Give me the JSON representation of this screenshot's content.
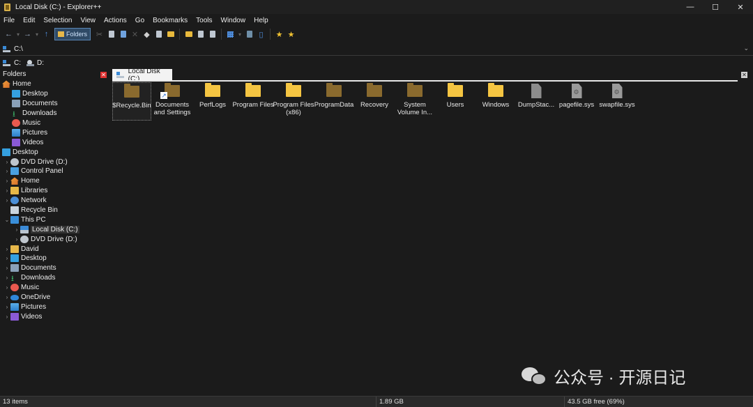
{
  "window": {
    "title": "Local Disk (C:) - Explorer++",
    "controls": [
      "—",
      "☐",
      "✕"
    ]
  },
  "menu": [
    "File",
    "Edit",
    "Selection",
    "View",
    "Actions",
    "Go",
    "Bookmarks",
    "Tools",
    "Window",
    "Help"
  ],
  "toolbar": {
    "folders_label": "Folders"
  },
  "address": {
    "path": "C:\\"
  },
  "drives": [
    "C:",
    "D:"
  ],
  "folders_pane": {
    "header": "Folders",
    "items": [
      {
        "label": "Home",
        "icon": "home-icon"
      },
      {
        "label": "Desktop",
        "icon": "desktop-icon"
      },
      {
        "label": "Documents",
        "icon": "documents-icon"
      },
      {
        "label": "Downloads",
        "icon": "downloads-icon"
      },
      {
        "label": "Music",
        "icon": "music-icon"
      },
      {
        "label": "Pictures",
        "icon": "pictures-icon"
      },
      {
        "label": "Videos",
        "icon": "videos-icon"
      },
      {
        "label": "Desktop",
        "icon": "desktop-icon"
      },
      {
        "label": "DVD Drive (D:)",
        "icon": "dvd-drive-icon"
      },
      {
        "label": "Control Panel",
        "icon": "control-panel-icon"
      },
      {
        "label": "Home",
        "icon": "home-icon"
      },
      {
        "label": "Libraries",
        "icon": "libraries-icon"
      },
      {
        "label": "Network",
        "icon": "network-icon"
      },
      {
        "label": "Recycle Bin",
        "icon": "recycle-bin-icon"
      },
      {
        "label": "This PC",
        "icon": "this-pc-icon"
      },
      {
        "label": "Local Disk (C:)",
        "icon": "local-disk-icon"
      },
      {
        "label": "DVD Drive (D:)",
        "icon": "dvd-drive-icon"
      },
      {
        "label": "David",
        "icon": "folder-icon"
      },
      {
        "label": "Desktop",
        "icon": "desktop-icon"
      },
      {
        "label": "Documents",
        "icon": "documents-icon"
      },
      {
        "label": "Downloads",
        "icon": "downloads-icon"
      },
      {
        "label": "Music",
        "icon": "music-icon"
      },
      {
        "label": "OneDrive",
        "icon": "onedrive-icon"
      },
      {
        "label": "Pictures",
        "icon": "pictures-icon"
      },
      {
        "label": "Videos",
        "icon": "videos-icon"
      }
    ]
  },
  "tab": {
    "label": "Local Disk (C:)"
  },
  "files": [
    {
      "name": "$Recycle.Bin",
      "type": "folder-system"
    },
    {
      "name": "Documents and Settings",
      "type": "folder-link"
    },
    {
      "name": "PerfLogs",
      "type": "folder"
    },
    {
      "name": "Program Files",
      "type": "folder"
    },
    {
      "name": "Program Files (x86)",
      "type": "folder"
    },
    {
      "name": "ProgramData",
      "type": "folder-system"
    },
    {
      "name": "Recovery",
      "type": "folder-system"
    },
    {
      "name": "System Volume In...",
      "type": "folder-system"
    },
    {
      "name": "Users",
      "type": "folder"
    },
    {
      "name": "Windows",
      "type": "folder"
    },
    {
      "name": "DumpStac...",
      "type": "file"
    },
    {
      "name": "pagefile.sys",
      "type": "file-system"
    },
    {
      "name": "swapfile.sys",
      "type": "file-system"
    }
  ],
  "watermark": {
    "text": "公众号 · 开源日记"
  },
  "status": {
    "items": "13 items",
    "size": "1.89 GB",
    "free": "43.5 GB free (69%)"
  }
}
